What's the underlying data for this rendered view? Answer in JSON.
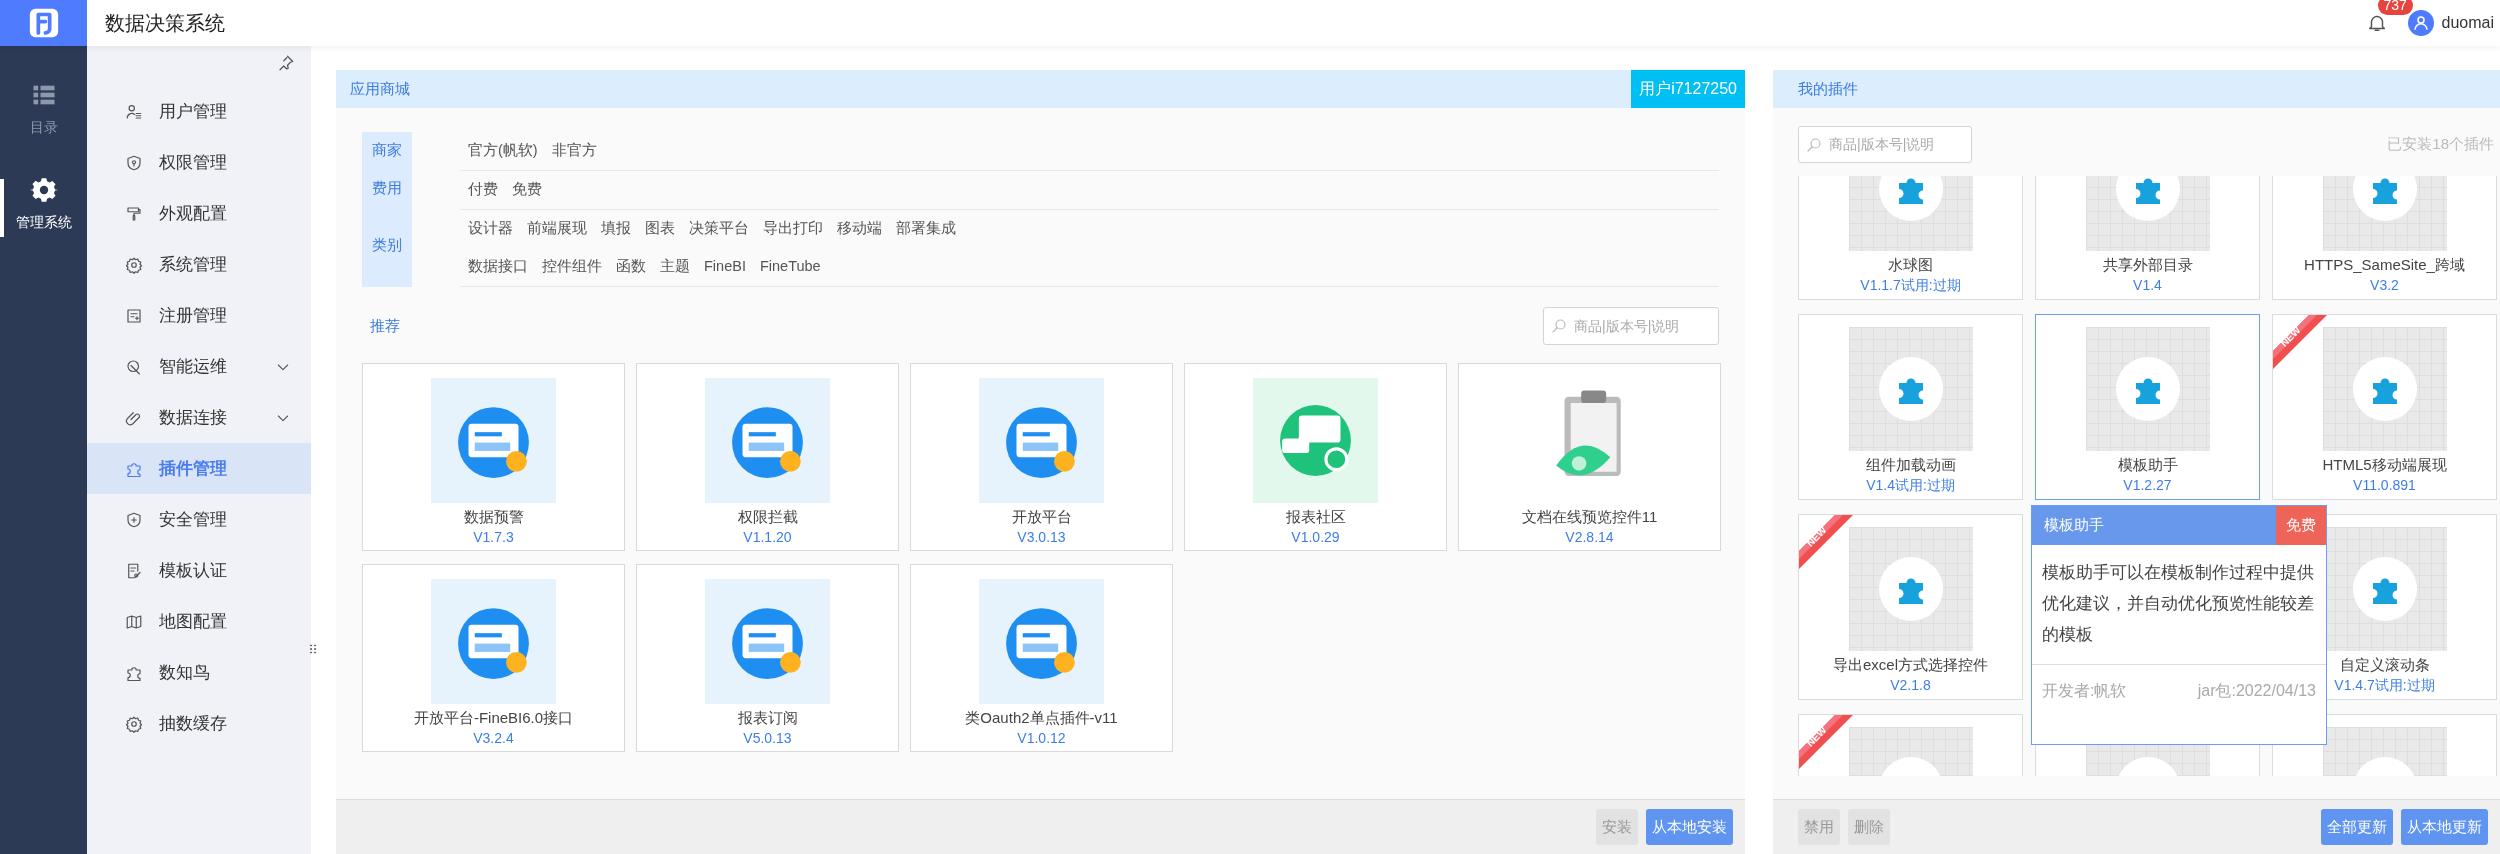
{
  "app": {
    "title": "数据决策系统"
  },
  "header": {
    "notifications": "737",
    "user": "duomai"
  },
  "rail": [
    {
      "label": "目录",
      "selected": false
    },
    {
      "label": "管理系统",
      "selected": true
    }
  ],
  "sidebar": {
    "items": [
      {
        "label": "用户管理",
        "kind": "item",
        "selected": false
      },
      {
        "label": "权限管理",
        "kind": "item",
        "selected": false
      },
      {
        "label": "外观配置",
        "kind": "item",
        "selected": false
      },
      {
        "label": "系统管理",
        "kind": "item",
        "selected": false
      },
      {
        "label": "注册管理",
        "kind": "item",
        "selected": false
      },
      {
        "label": "智能运维",
        "kind": "group",
        "expanded": false,
        "selected": false
      },
      {
        "label": "数据连接",
        "kind": "group",
        "expanded": false,
        "selected": false
      },
      {
        "label": "插件管理",
        "kind": "item",
        "selected": true
      },
      {
        "label": "安全管理",
        "kind": "item",
        "selected": false
      },
      {
        "label": "模板认证",
        "kind": "item",
        "selected": false
      },
      {
        "label": "地图配置",
        "kind": "item",
        "selected": false
      },
      {
        "label": "数知鸟",
        "kind": "item",
        "selected": false
      },
      {
        "label": "抽数缓存",
        "kind": "item",
        "selected": false
      }
    ]
  },
  "store": {
    "title": "应用商城",
    "account": "用户i7127250",
    "filters": [
      {
        "label": "商家",
        "lines": [
          [
            "官方(帆软)",
            "非官方"
          ]
        ]
      },
      {
        "label": "费用",
        "lines": [
          [
            "付费",
            "免费"
          ]
        ]
      },
      {
        "label": "类别",
        "lines": [
          [
            "设计器",
            "前端展现",
            "填报",
            "图表",
            "决策平台",
            "导出打印",
            "移动端",
            "部署集成"
          ],
          [
            "数据接口",
            "控件组件",
            "函数",
            "主题",
            "FineBI",
            "FineTube"
          ]
        ]
      }
    ],
    "section": "推荐",
    "search": {
      "placeholder": "商品|版本号|说明"
    },
    "apps": [
      {
        "name": "数据预警",
        "version": "V1.7.3",
        "kind": "tile"
      },
      {
        "name": "权限拦截",
        "version": "V1.1.20",
        "kind": "tile"
      },
      {
        "name": "开放平台",
        "version": "V3.0.13",
        "kind": "tile"
      },
      {
        "name": "报表社区",
        "version": "V1.0.29",
        "kind": "chat"
      },
      {
        "name": "文档在线预览控件11",
        "version": "V2.8.14",
        "kind": "document"
      },
      {
        "name": "开放平台-FineBI6.0接口",
        "version": "V3.2.4",
        "kind": "tile"
      },
      {
        "name": "报表订阅",
        "version": "V5.0.13",
        "kind": "tile"
      },
      {
        "name": "类Oauth2单点插件-v11",
        "version": "V1.0.12",
        "kind": "tile"
      }
    ],
    "buttons": [
      {
        "label": "安装",
        "disabled": true
      },
      {
        "label": "从本地安装",
        "disabled": false
      }
    ]
  },
  "my_plugins": {
    "title": "我的插件",
    "search": {
      "placeholder": "商品|版本号|说明"
    },
    "count": "已安装18个插件",
    "plugins": [
      {
        "name": "水球图",
        "version": "V1.1.7试用:过期",
        "selected": false
      },
      {
        "name": "共享外部目录",
        "version": "V1.4",
        "selected": false
      },
      {
        "name": "HTTPS_SameSite_跨域",
        "version": "V3.2",
        "selected": false
      },
      {
        "name": "组件加载动画",
        "version": "V1.4试用:过期",
        "selected": false
      },
      {
        "name": "模板助手",
        "version": "V1.2.27",
        "selected": true
      },
      {
        "name": "HTML5移动端展现",
        "version": "V11.0.891",
        "selected": false,
        "ribbon": "NEW"
      },
      {
        "name": "导出excel方式选择控件",
        "version": "V2.1.8",
        "selected": false,
        "ribbon": "NEW"
      },
      {
        "name": "自定义滚动条",
        "version": "V1.4.7试用:过期",
        "selected": false
      },
      {
        "selected": false,
        "ribbon": "NEW"
      },
      {
        "selected": false
      },
      {
        "selected": false
      }
    ],
    "tooltip": {
      "title": "模板助手",
      "price": "免费",
      "description": "模板助手可以在模板制作过程中提供优化建议，并自动优化预览性能较差的模板",
      "developer": "开发者:帆软",
      "jar": "jar包:2022/04/13"
    },
    "buttons_left": [
      {
        "label": "禁用",
        "disabled": true
      },
      {
        "label": "删除",
        "disabled": true
      }
    ],
    "buttons_right": [
      {
        "label": "全部更新",
        "disabled": false
      },
      {
        "label": "从本地更新",
        "disabled": false
      }
    ]
  }
}
